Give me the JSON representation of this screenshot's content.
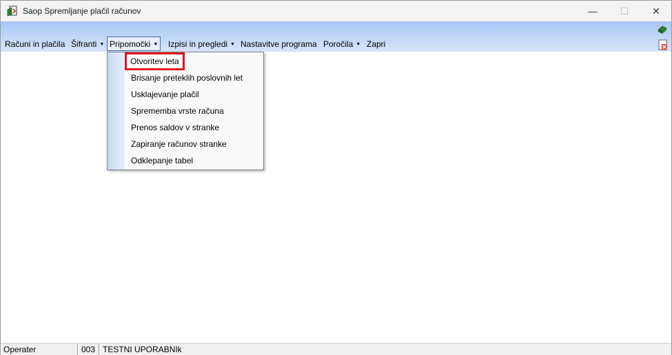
{
  "window": {
    "title": "Saop Spremljanje plačil računov",
    "min_glyph": "—",
    "max_glyph": "☐",
    "close_glyph": "✕"
  },
  "menubar": {
    "items": [
      {
        "label": "Računi in plačila",
        "has_arrow": false
      },
      {
        "label": "Šifranti",
        "has_arrow": true
      },
      {
        "label": "Pripomočki",
        "has_arrow": true,
        "open": true
      },
      {
        "label": "Izpisi in pregledi",
        "has_arrow": true
      },
      {
        "label": "Nastavitve programa",
        "has_arrow": false
      },
      {
        "label": "Poročila",
        "has_arrow": true
      },
      {
        "label": "Zapri",
        "has_arrow": false
      }
    ],
    "arrow_glyph": "▼"
  },
  "dropdown": {
    "items": [
      {
        "label": "Otvoritev leta",
        "highlighted": true
      },
      {
        "label": "Brisanje preteklih poslovnih let"
      },
      {
        "label": "Usklajevanje plačil"
      },
      {
        "label": "Sprememba vrste računa"
      },
      {
        "label": "Prenos saldov v stranke"
      },
      {
        "label": "Zapiranje računov stranke"
      },
      {
        "label": "Odklepanje tabel"
      }
    ],
    "highlight_color": "#e0141e"
  },
  "statusbar": {
    "user_label": "Operater",
    "user_code": "003",
    "user_name": "TESTNI UPORABNIk"
  },
  "colors": {
    "menubar_top": "#a8c6f5",
    "menubar_bottom": "#d6e4fb",
    "menu_open_border": "#3d6ab3"
  }
}
